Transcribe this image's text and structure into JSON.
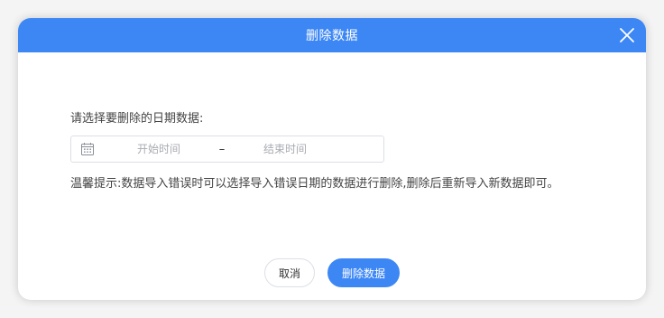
{
  "dialog": {
    "title": "删除数据",
    "close_icon": "close-icon",
    "prompt": "请选择要删除的日期数据:",
    "date_range": {
      "icon": "calendar-icon",
      "start_placeholder": "开始时间",
      "separator": "–",
      "end_placeholder": "结束时间"
    },
    "hint": "温馨提示:数据导入错误时可以选择导入错误日期的数据进行删除,删除后重新导入新数据即可。",
    "buttons": {
      "cancel_label": "取消",
      "confirm_label": "删除数据"
    }
  },
  "colors": {
    "accent": "#3d87f5",
    "text": "#444444",
    "placeholder": "#a8abb2",
    "border": "#dcdfe6"
  }
}
